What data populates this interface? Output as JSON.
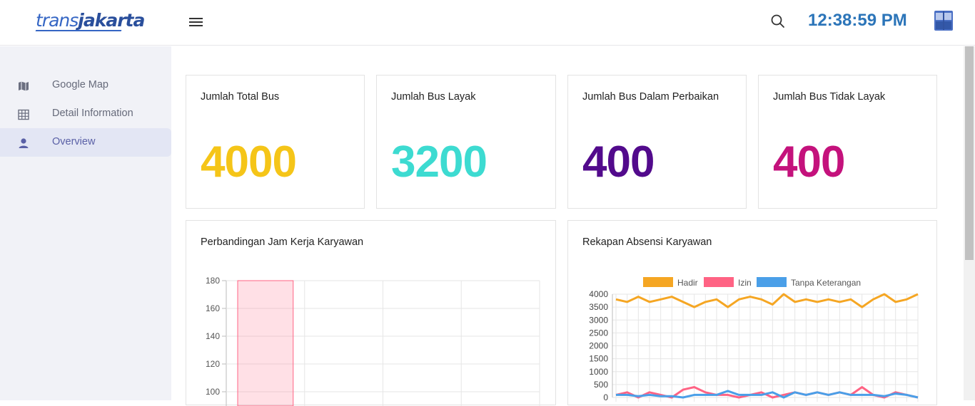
{
  "header": {
    "logo_text_1": "trans",
    "logo_text_2": "jakarta",
    "clock": "12:38:59 PM"
  },
  "sidebar": {
    "items": [
      {
        "label": "Google Map",
        "icon": "map-icon"
      },
      {
        "label": "Detail Information",
        "icon": "grid-icon"
      },
      {
        "label": "Overview",
        "icon": "user-icon",
        "active": true
      }
    ]
  },
  "stats": [
    {
      "title": "Jumlah Total Bus",
      "value": "4000",
      "color": "#f5c518"
    },
    {
      "title": "Jumlah Bus Layak",
      "value": "3200",
      "color": "#3ddbd1"
    },
    {
      "title": "Jumlah Bus Dalam Perbaikan",
      "value": "400",
      "color": "#520a8c"
    },
    {
      "title": "Jumlah Bus Tidak Layak",
      "value": "400",
      "color": "#c4127c"
    }
  ],
  "charts": {
    "left_title": "Perbandingan Jam Kerja Karyawan",
    "right_title": "Rekapan Absensi Karyawan"
  },
  "chart_data": [
    {
      "type": "bar",
      "title": "Perbandingan Jam Kerja Karyawan",
      "y_ticks": [
        100,
        120,
        140,
        160,
        180
      ],
      "ylim": [
        90,
        180
      ],
      "series": [
        {
          "values": [
            180
          ],
          "color": "#ff6384"
        }
      ],
      "grid": true
    },
    {
      "type": "line",
      "title": "Rekapan Absensi Karyawan",
      "legend": "top",
      "y_ticks": [
        0,
        500,
        1000,
        1500,
        2000,
        2500,
        3000,
        3500,
        4000
      ],
      "ylim": [
        0,
        4000
      ],
      "grid": true,
      "series": [
        {
          "name": "Hadir",
          "color": "#f5a623",
          "values": [
            3800,
            3700,
            3900,
            3700,
            3800,
            3900,
            3700,
            3500,
            3700,
            3800,
            3500,
            3800,
            3900,
            3800,
            3600,
            4000,
            3700,
            3800,
            3700,
            3800,
            3700,
            3800,
            3500,
            3800,
            4000,
            3700,
            3800,
            4000
          ]
        },
        {
          "name": "Izin",
          "color": "#ff6384",
          "values": [
            100,
            200,
            0,
            200,
            100,
            0,
            300,
            400,
            200,
            100,
            100,
            0,
            100,
            200,
            0,
            100,
            200,
            100,
            200,
            100,
            200,
            100,
            400,
            100,
            0,
            200,
            100,
            0
          ]
        },
        {
          "name": "Tanpa Keterangan",
          "color": "#4a9fe8",
          "values": [
            100,
            100,
            50,
            100,
            50,
            50,
            0,
            100,
            100,
            100,
            250,
            100,
            100,
            100,
            200,
            0,
            200,
            100,
            200,
            100,
            200,
            100,
            100,
            100,
            50,
            150,
            100,
            0
          ]
        }
      ]
    }
  ]
}
